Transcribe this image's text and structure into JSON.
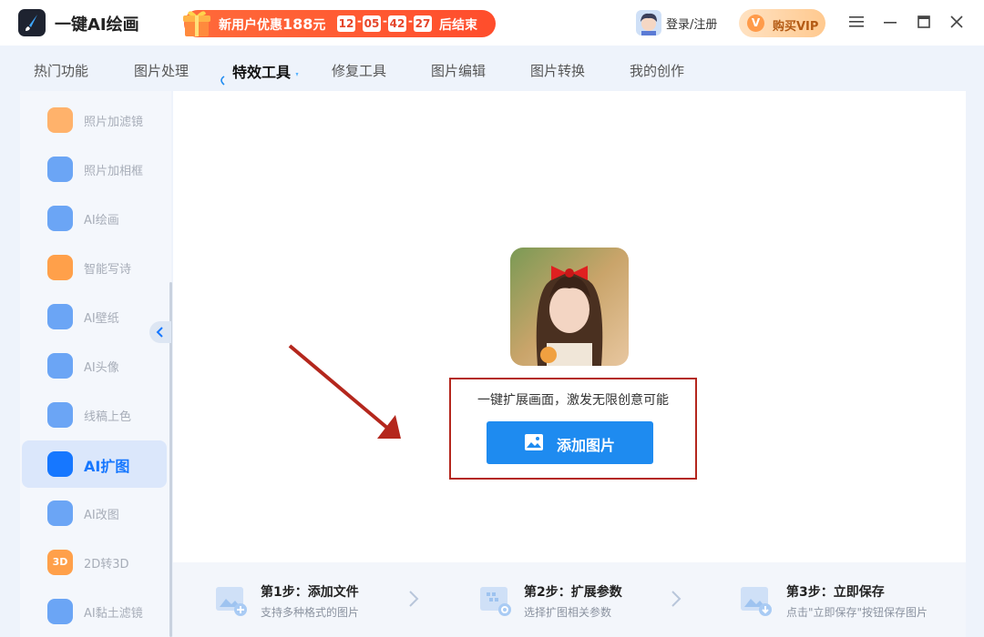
{
  "app": {
    "title": "一键AI绘画"
  },
  "promo": {
    "text": "新用户优惠",
    "amount": "188",
    "unit": "元",
    "timer": [
      "12",
      "05",
      "42",
      "27"
    ],
    "end_text": "后结束"
  },
  "header": {
    "login": "登录/注册",
    "vip": "购买VIP",
    "vip_icon_text": "V"
  },
  "tabs": [
    {
      "label": "热门功能"
    },
    {
      "label": "图片处理"
    },
    {
      "label": "特效工具"
    },
    {
      "label": "修复工具"
    },
    {
      "label": "图片编辑"
    },
    {
      "label": "图片转换"
    },
    {
      "label": "我的创作"
    }
  ],
  "active_tab": "特效工具",
  "sidebar": {
    "items": [
      {
        "label": "照片加滤镜",
        "icon": "filter-icon",
        "color": "#ffb26b"
      },
      {
        "label": "照片加相框",
        "icon": "frame-icon",
        "color": "#6ba5f5"
      },
      {
        "label": "AI绘画",
        "icon": "robot-icon",
        "color": "#6ba5f5"
      },
      {
        "label": "智能写诗",
        "icon": "poem-icon",
        "color": "#ffa04a"
      },
      {
        "label": "AI壁纸",
        "icon": "wallpaper-icon",
        "color": "#6ba5f5"
      },
      {
        "label": "AI头像",
        "icon": "portrait-icon",
        "color": "#6ba5f5"
      },
      {
        "label": "线稿上色",
        "icon": "colorize-icon",
        "color": "#6ba5f5"
      },
      {
        "label": "AI扩图",
        "icon": "expand-icon",
        "color": "#1677ff",
        "active": true
      },
      {
        "label": "AI改图",
        "icon": "modify-icon",
        "color": "#6ba5f5"
      },
      {
        "label": "2D转3D",
        "icon": "3d-icon",
        "color": "#ffa04a",
        "badge": "3D"
      },
      {
        "label": "AI黏土滤镜",
        "icon": "clay-icon",
        "color": "#6ba5f5"
      }
    ]
  },
  "main": {
    "slogan": "一键扩展画面，激发无限创意可能",
    "add_button": "添加图片"
  },
  "steps": [
    {
      "title": "第1步：添加文件",
      "desc": "支持多种格式的图片"
    },
    {
      "title": "第2步：扩展参数",
      "desc": "选择扩图相关参数"
    },
    {
      "title": "第3步：立即保存",
      "desc": "点击\"立即保存\"按钮保存图片"
    }
  ],
  "colors": {
    "accent": "#1677ff",
    "button": "#1e8bf0",
    "callout": "#b4271d",
    "promo": "#ff5a30"
  }
}
